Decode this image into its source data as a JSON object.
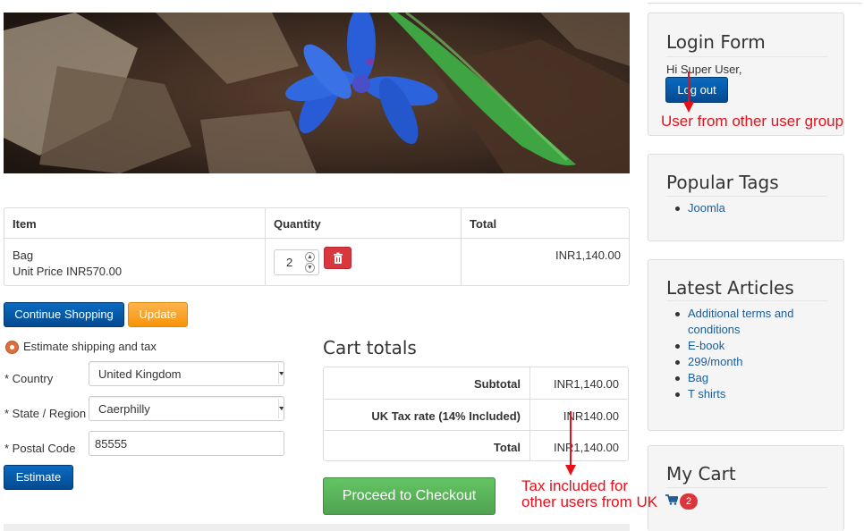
{
  "cart": {
    "headers": {
      "item": "Item",
      "quantity": "Quantity",
      "total": "Total"
    },
    "item": {
      "name": "Bag",
      "unit_price": "Unit Price INR570.00",
      "quantity": "2",
      "total": "INR1,140.00"
    }
  },
  "actions": {
    "continue_shopping": "Continue Shopping",
    "update": "Update"
  },
  "shipping": {
    "title": "Estimate shipping and tax",
    "country_label": "* Country",
    "country_value": "United Kingdom",
    "state_label": "* State / Region",
    "state_value": "Caerphilly",
    "postal_label": "* Postal Code",
    "postal_value": "85555",
    "estimate_button": "Estimate"
  },
  "totals": {
    "title": "Cart totals",
    "rows": [
      {
        "label": "Subtotal",
        "value": "INR1,140.00"
      },
      {
        "label": "UK Tax rate (14% Included)",
        "value": "INR140.00"
      },
      {
        "label": "Total",
        "value": "INR1,140.00"
      }
    ],
    "checkout_button": "Proceed to Checkout"
  },
  "sidebar": {
    "login": {
      "title": "Login Form",
      "greeting": "Hi Super User,",
      "logout": "Log out"
    },
    "tags": {
      "title": "Popular Tags",
      "items": [
        "Joomla"
      ]
    },
    "articles": {
      "title": "Latest Articles",
      "items": [
        "Additional terms and conditions",
        "E-book",
        "299/month",
        "Bag",
        "T shirts"
      ]
    },
    "mycart": {
      "title": "My Cart",
      "count": "2"
    }
  },
  "annotations": {
    "user_group": "User from other user group",
    "tax_line1": "Tax included for",
    "tax_line2": "other users from UK"
  },
  "colors": {
    "annotation": "#e5101a",
    "primary": "#044a91",
    "link": "#1c5d9b",
    "success": "#51a351",
    "warning": "#f89406"
  }
}
